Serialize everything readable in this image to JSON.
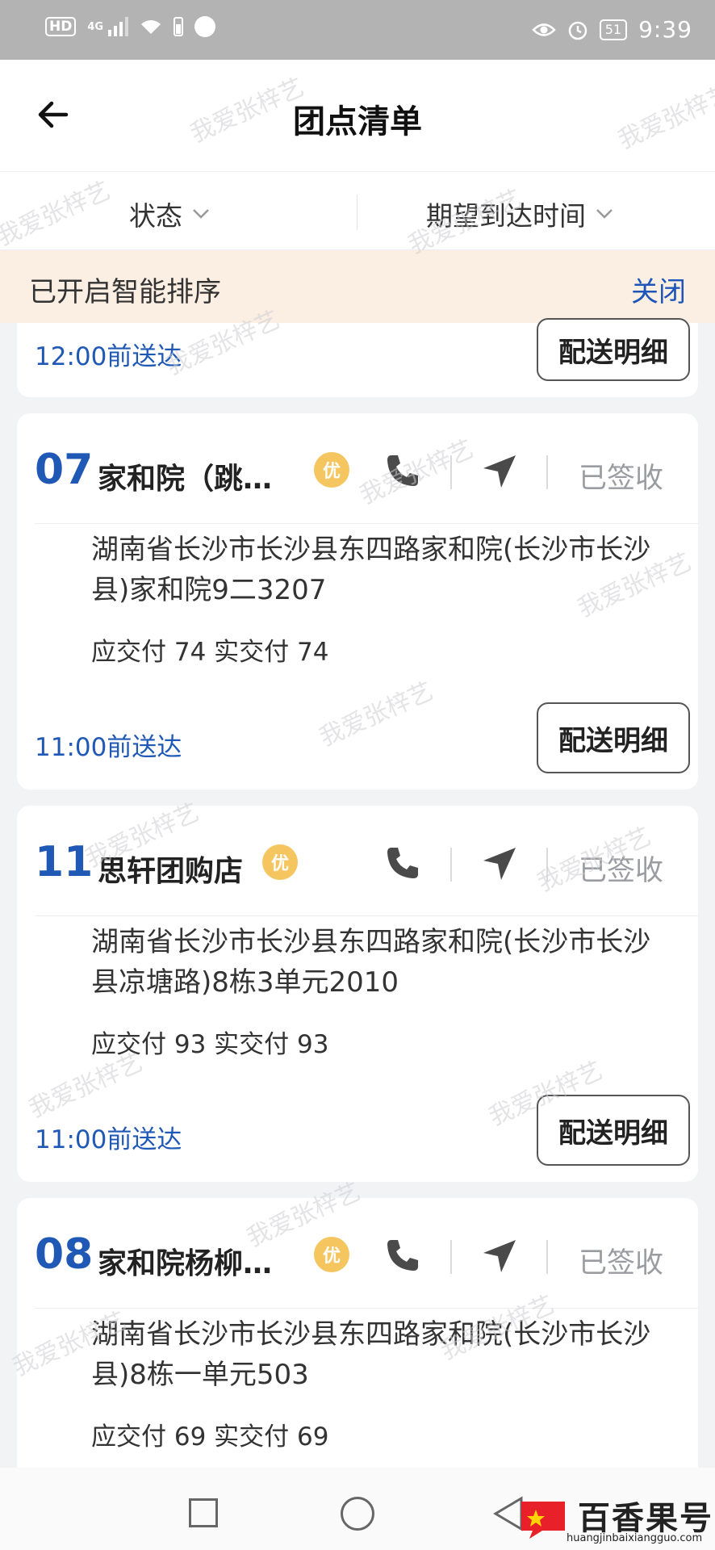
{
  "status_bar": {
    "hd": "HD",
    "network": "4G",
    "battery": "51",
    "time": "9:39"
  },
  "header": {
    "title": "团点清单"
  },
  "filters": {
    "status_label": "状态",
    "time_label": "期望到达时间"
  },
  "smart_sort": {
    "text": "已开启智能排序",
    "close_label": "关闭"
  },
  "partial_card": {
    "deliver_time": "12:00前送达",
    "detail_label": "配送明细"
  },
  "cards": [
    {
      "number": "07",
      "name": "家和院（跳…",
      "badge": "优",
      "status": "已签收",
      "address": "湖南省长沙市长沙县东四路家和院(长沙市长沙县)家和院9二3207",
      "payment": "应交付 74 实交付 74",
      "deliver_time": "11:00前送达",
      "detail_label": "配送明细"
    },
    {
      "number": "11",
      "name": "思轩团购店",
      "badge": "优",
      "status": "已签收",
      "address": "湖南省长沙市长沙县东四路家和院(长沙市长沙县凉塘路)8栋3单元2010",
      "payment": "应交付 93 实交付 93",
      "deliver_time": "11:00前送达",
      "detail_label": "配送明细"
    },
    {
      "number": "08",
      "name": "家和院杨柳…",
      "badge": "优",
      "status": "已签收",
      "address": "湖南省长沙市长沙县东四路家和院(长沙市长沙县)8栋一单元503",
      "payment": "应交付 69 实交付 69"
    }
  ],
  "watermark": "我爱张梓艺",
  "brand": {
    "name": "百香果号",
    "url": "huangjinbaixiangguo.com"
  },
  "colors": {
    "accent_blue": "#1f58b5",
    "banner_bg": "#fbeee2",
    "badge": "#f5c660",
    "muted": "#9a9ca1"
  }
}
